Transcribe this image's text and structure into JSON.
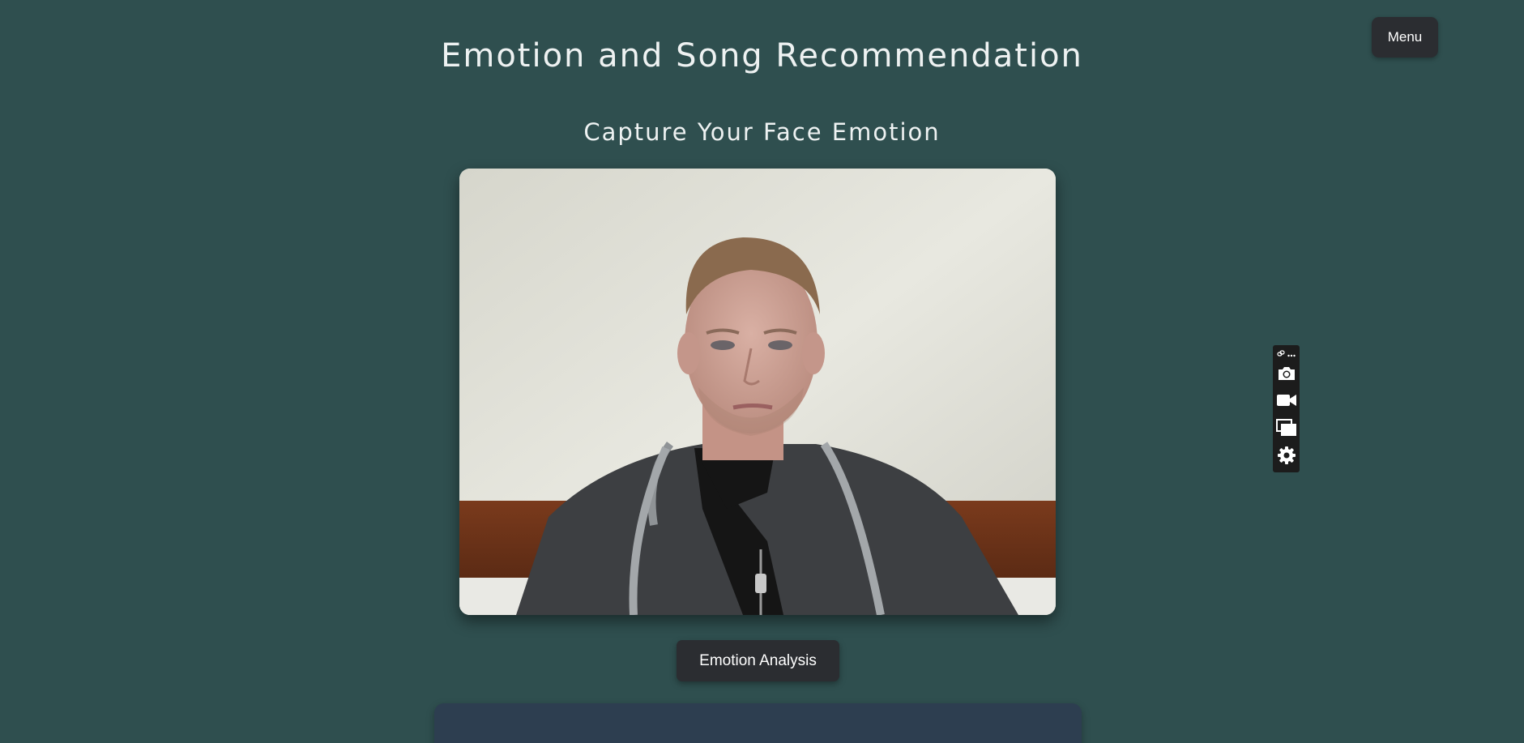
{
  "header": {
    "title": "Emotion and Song Recommendation",
    "menu_label": "Menu"
  },
  "capture": {
    "heading": "Capture Your Face Emotion",
    "analyze_label": "Emotion Analysis"
  },
  "toolbar": {
    "icons": [
      "link-icon",
      "more-icon",
      "camera-icon",
      "video-icon",
      "screens-icon",
      "gear-icon"
    ]
  },
  "colors": {
    "background": "#2f4f4f",
    "button": "#2b2d31",
    "panel": "#2d3e50",
    "toolbar": "#1c1c1c"
  }
}
